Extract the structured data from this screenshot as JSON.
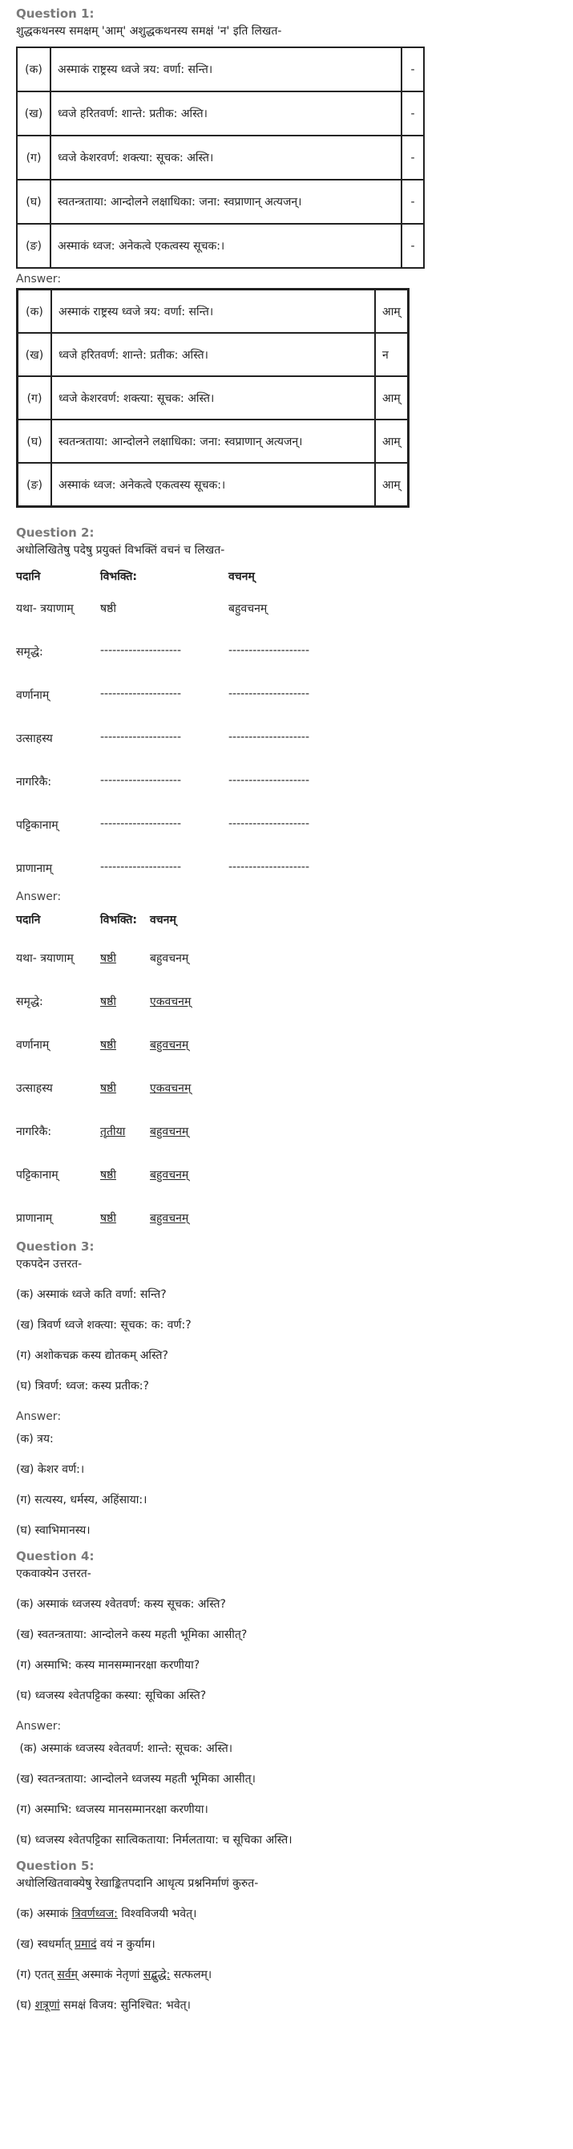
{
  "q1": {
    "heading": "Question 1:",
    "instruction": "शुद्धकथनस्य समक्षम् 'आम्' अशुद्धकथनस्य समक्षं 'न' इति लिखत-",
    "rows": [
      {
        "label": "(क)",
        "text": "अस्माकं राष्ट्रस्य ध्वजे त्रय: वर्णा: सन्ति।",
        "mark": "-"
      },
      {
        "label": "(ख)",
        "text": "ध्वजे हरितवर्ण: शान्ते: प्रतीक: अस्ति।",
        "mark": "-"
      },
      {
        "label": "(ग)",
        "text": "ध्वजे केशरवर्ण: शक्त्या: सूचक: अस्ति।",
        "mark": "-"
      },
      {
        "label": "(घ)",
        "text": "स्वतन्त्रताया: आन्दोलने लक्षाधिका: जना: स्वप्राणान् अत्यजन्।",
        "mark": "-"
      },
      {
        "label": "(ङ)",
        "text": "अस्माकं ध्वज: अनेकत्वे एकत्वस्य सूचक:।",
        "mark": "-"
      }
    ],
    "answer_label": "Answer:",
    "answers": [
      {
        "label": "(क)",
        "text": "अस्माकं राष्ट्रस्य ध्वजे त्रय: वर्णा: सन्ति।",
        "mark": "आम्"
      },
      {
        "label": "(ख)",
        "text": "ध्वजे हरितवर्ण: शान्ते: प्रतीक: अस्ति।",
        "mark": "न"
      },
      {
        "label": "(ग)",
        "text": "ध्वजे केशरवर्ण: शक्त्या: सूचक: अस्ति।",
        "mark": "आम्"
      },
      {
        "label": "(घ)",
        "text": "स्वतन्त्रताया: आन्दोलने लक्षाधिका: जना: स्वप्राणान् अत्यजन्।",
        "mark": "आम्"
      },
      {
        "label": "(ङ)",
        "text": "अस्माकं ध्वज: अनेकत्वे एकत्वस्य सूचक:।",
        "mark": "आम्"
      }
    ]
  },
  "q2": {
    "heading": "Question 2:",
    "instruction": "अधोलिखितेषु पदेषु प्रयुक्तं विभक्तिं वचनं च लिखत-",
    "headers": {
      "col1": "पदानि",
      "col2": "विभक्ति:",
      "col3": "वचनम्"
    },
    "rows": [
      {
        "word": "यथा- त्रयाणाम्",
        "vibhakti": "षष्ठी",
        "vachan": "बहुवचनम्"
      },
      {
        "word": "समृद्धे:",
        "vibhakti": "--------------------",
        "vachan": "--------------------"
      },
      {
        "word": "वर्णानाम्",
        "vibhakti": "--------------------",
        "vachan": "--------------------"
      },
      {
        "word": "उत्साहस्य",
        "vibhakti": "--------------------",
        "vachan": "--------------------"
      },
      {
        "word": "नागरिकै:",
        "vibhakti": "--------------------",
        "vachan": "--------------------"
      },
      {
        "word": "पट्टिकानाम्",
        "vibhakti": "--------------------",
        "vachan": "--------------------"
      },
      {
        "word": "प्राणानाम्",
        "vibhakti": "--------------------",
        "vachan": "--------------------"
      }
    ],
    "answer_label": "Answer:",
    "answer_headers": {
      "col1": "पदानि",
      "col2": "विभक्ति:",
      "col3": "वचनम्"
    },
    "answers": [
      {
        "word": "यथा- त्रयाणाम्",
        "vibhakti": "षष्ठी",
        "vachan": "बहुवचनम्"
      },
      {
        "word": "समृद्धे:",
        "vibhakti": "षष्ठी",
        "vachan": "एकवचनम्"
      },
      {
        "word": "वर्णानाम्",
        "vibhakti": "षष्ठी",
        "vachan": "बहुवचनम्"
      },
      {
        "word": "उत्साहस्य",
        "vibhakti": "षष्ठी",
        "vachan": "एकवचनम्"
      },
      {
        "word": "नागरिकै:",
        "vibhakti": "तृतीया",
        "vachan": "बहुवचनम्"
      },
      {
        "word": "पट्टिकानाम्",
        "vibhakti": "षष्ठी",
        "vachan": "बहुवचनम्"
      },
      {
        "word": "प्राणानाम्",
        "vibhakti": "षष्ठी",
        "vachan": "बहुवचनम्"
      }
    ]
  },
  "q3": {
    "heading": "Question 3:",
    "instruction": "एकपदेन उत्तरत-",
    "items": [
      "(क) अस्माकं ध्वजे कति वर्णा: सन्ति?",
      "(ख) त्रिवर्ण ध्वजे शक्त्या: सूचक: क: वर्ण:?",
      "(ग) अशोकचक्र कस्य द्योतकम् अस्ति?",
      "(घ) त्रिवर्ण: ध्वज: कस्य प्रतीक:?"
    ],
    "answer_label": "Answer:",
    "answers": [
      "(क) त्रय:",
      "(ख) केशर वर्ण:।",
      "(ग) सत्यस्य, धर्मस्य, अहिंसाया:।",
      "(घ) स्वाभिमानस्य।"
    ]
  },
  "q4": {
    "heading": "Question 4:",
    "instruction": "एकवाक्येन उत्तरत-",
    "items": [
      "(क) अस्माकं ध्वजस्य श्वेतवर्ण: कस्य सूचक: अस्ति?",
      "(ख) स्वतन्त्रताया: आन्दोलने कस्य महती भूमिका आसीत्?",
      "(ग) अस्माभि: कस्य मानसम्मानरक्षा करणीया?",
      "(घ) ध्वजस्य श्वेतपट्टिका कस्या: सूचिका अस्ति?"
    ],
    "answer_label": "Answer:",
    "answers": [
      " (क) अस्माकं ध्वजस्य श्वेतवर्ण: शान्ते: सूचक: अस्ति।",
      "(ख) स्वतन्त्रताया: आन्दोलने ध्वजस्य महती भूमिका आसीत्।",
      "(ग) अस्माभि: ध्वजस्य मानसम्मानरक्षा करणीया।",
      "(घ) ध्वजस्य श्वेतपट्टिका सात्विकताया: निर्मलताया: च सूचिका अस्ति।"
    ]
  },
  "q5": {
    "heading": "Question 5:",
    "instruction": "अधोलिखितवाक्येषु रेखाङ्कितपदानि आधृत्य प्रश्ननिर्माणं कुरुत-",
    "items": [
      {
        "pre": "(क) अस्माकं ",
        "u": "त्रिवर्णध्वज:",
        "post": " विश्वविजयी भवेत्।"
      },
      {
        "pre": "(ख) स्वधर्मात् ",
        "u": "प्रमादं",
        "post": " वयं न कुर्याम।"
      },
      {
        "pre": "(ग) एतत् ",
        "u": "सर्वम्",
        "post": " अस्माकं नेतृणां ",
        "u2": "सद्बुद्धे:",
        "post2": " सत्फलम्।"
      },
      {
        "pre": "(घ) ",
        "u": "शत्रूणां",
        "post": " समक्षं विजय: सुनिश्चित: भवेत्।"
      }
    ]
  }
}
